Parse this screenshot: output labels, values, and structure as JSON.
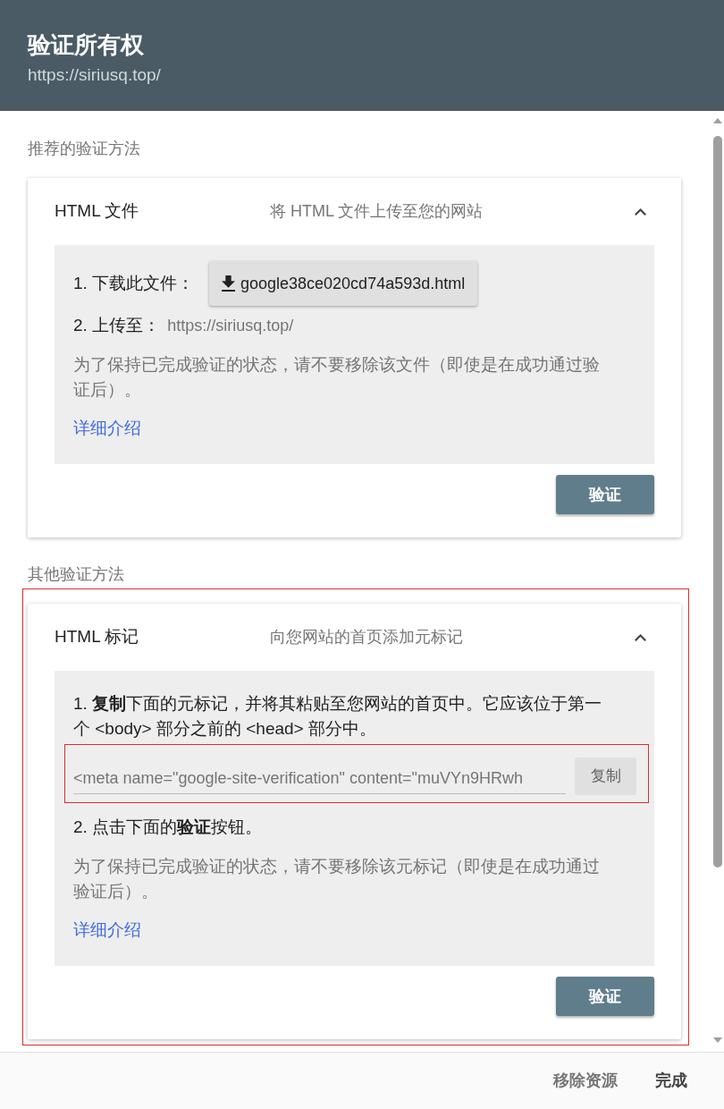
{
  "dialog": {
    "title": "验证所有权",
    "subtitle": "https://siriusq.top/"
  },
  "sections": [
    {
      "heading": "推荐的验证方法",
      "highlighted": false,
      "method": {
        "name": "HTML 文件",
        "description": "将 HTML 文件上传至您的网站",
        "expanded": true,
        "steps": [
          {
            "kind": "download",
            "label": "1. 下载此文件：",
            "button": "google38ce020cd74a593d.html"
          },
          {
            "kind": "url",
            "label": "2. 上传至：",
            "value": "https://siriusq.top/"
          }
        ],
        "note": "为了保持已完成验证的状态，请不要移除该文件（即使是在成功通过验证后）。",
        "link": "详细介绍",
        "verify_button": "验证"
      }
    },
    {
      "heading": "其他验证方法",
      "highlighted": true,
      "method": {
        "name": "HTML 标记",
        "description": "向您网站的首页添加元标记",
        "expanded": true,
        "steps": [
          {
            "kind": "instruction",
            "text": "1. **复制**下面的元标记，并将其粘贴至您网站的首页中。它应该位于第一个 <body> 部分之前的 <head> 部分中。"
          },
          {
            "kind": "copy_field",
            "value": "<meta name=\"google-site-verification\" content=\"muVYn9HRwh",
            "button": "复制",
            "highlighted": true
          },
          {
            "kind": "instruction",
            "text": "2. 点击下面的**验证**按钮。"
          }
        ],
        "note": "为了保持已完成验证的状态，请不要移除该元标记（即使是在成功通过验证后）。",
        "link": "详细介绍",
        "verify_button": "验证"
      }
    }
  ],
  "footer": {
    "buttons": [
      {
        "label": "移除资源",
        "kind": "secondary"
      },
      {
        "label": "完成",
        "kind": "primary"
      }
    ]
  }
}
